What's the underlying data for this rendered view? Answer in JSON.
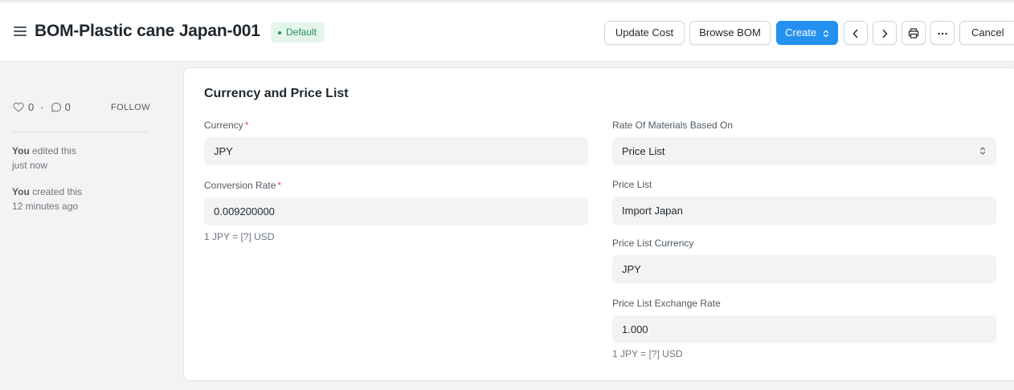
{
  "header": {
    "title": "BOM-Plastic cane Japan-001",
    "status_badge": "Default",
    "buttons": {
      "update_cost": "Update Cost",
      "browse_bom": "Browse BOM",
      "create": "Create",
      "cancel": "Cancel"
    },
    "icons": [
      "menu-icon",
      "chevron-left-icon",
      "chevron-right-icon",
      "printer-icon",
      "more-icon",
      "sort-icon"
    ]
  },
  "sidebar": {
    "likes_count": "0",
    "comments_count": "0",
    "separator": "·",
    "follow_label": "FOLLOW",
    "activity": [
      {
        "user": "You",
        "action": "edited this",
        "time": "just now"
      },
      {
        "user": "You",
        "action": "created this",
        "time": "12 minutes ago"
      }
    ]
  },
  "section": {
    "title": "Currency and Price List",
    "left": {
      "currency_label": "Currency",
      "currency_value": "JPY",
      "conversion_rate_label": "Conversion Rate",
      "conversion_rate_value": "0.009200000",
      "conversion_hint": "1 JPY = [?] USD"
    },
    "right": {
      "rate_based_on_label": "Rate Of Materials Based On",
      "rate_based_on_value": "Price List",
      "price_list_label": "Price List",
      "price_list_value": "Import Japan",
      "price_list_currency_label": "Price List Currency",
      "price_list_currency_value": "JPY",
      "exchange_rate_label": "Price List Exchange Rate",
      "exchange_rate_value": "1.000",
      "exchange_hint": "1 JPY = [?] USD"
    },
    "required_marker": "*"
  },
  "colors": {
    "primary": "#2490ef",
    "badge_bg": "#e4f5e9",
    "badge_text": "#278f5e",
    "required": "#e24c4c"
  }
}
